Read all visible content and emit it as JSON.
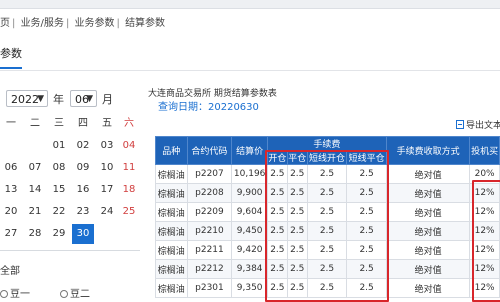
{
  "breadcrumb": [
    "页",
    "业务/服务",
    "业务参数",
    "结算参数"
  ],
  "tab": {
    "label": "参数"
  },
  "calendar": {
    "year": "2022",
    "year_unit": "年",
    "month": "06",
    "month_unit": "月",
    "weekdays": [
      "一",
      "二",
      "三",
      "四",
      "五",
      "六"
    ],
    "weeks": [
      [
        "",
        "",
        "01",
        "02",
        "03",
        "04"
      ],
      [
        "06",
        "07",
        "08",
        "09",
        "10",
        "11"
      ],
      [
        "13",
        "14",
        "15",
        "16",
        "17",
        "18"
      ],
      [
        "20",
        "21",
        "22",
        "23",
        "24",
        "25"
      ],
      [
        "27",
        "28",
        "29",
        "30",
        "",
        ""
      ]
    ],
    "selected_day": "30"
  },
  "filters": {
    "all": "全部",
    "opt1": "豆一",
    "opt2": "豆二"
  },
  "content": {
    "title": "大连商品交易所 期货结算参数表",
    "date_label": "查询日期：20220630",
    "export_label": "导出文本"
  },
  "table": {
    "group_fee": "手续费",
    "headers": [
      "品种",
      "合约代码",
      "结算价",
      "开仓",
      "平仓",
      "短线开仓",
      "短线平仓",
      "手续费收取方式",
      "投机买"
    ],
    "rows": [
      [
        "棕榈油",
        "p2207",
        "10,196",
        "2.5",
        "2.5",
        "2.5",
        "2.5",
        "绝对值",
        "20%"
      ],
      [
        "棕榈油",
        "p2208",
        "9,900",
        "2.5",
        "2.5",
        "2.5",
        "2.5",
        "绝对值",
        "12%"
      ],
      [
        "棕榈油",
        "p2209",
        "9,604",
        "2.5",
        "2.5",
        "2.5",
        "2.5",
        "绝对值",
        "12%"
      ],
      [
        "棕榈油",
        "p2210",
        "9,450",
        "2.5",
        "2.5",
        "2.5",
        "2.5",
        "绝对值",
        "12%"
      ],
      [
        "棕榈油",
        "p2211",
        "9,420",
        "2.5",
        "2.5",
        "2.5",
        "2.5",
        "绝对值",
        "12%"
      ],
      [
        "棕榈油",
        "p2212",
        "9,384",
        "2.5",
        "2.5",
        "2.5",
        "2.5",
        "绝对值",
        "12%"
      ],
      [
        "棕榈油",
        "p2301",
        "9,350",
        "2.5",
        "2.5",
        "2.5",
        "2.5",
        "绝对值",
        "12%"
      ]
    ]
  }
}
